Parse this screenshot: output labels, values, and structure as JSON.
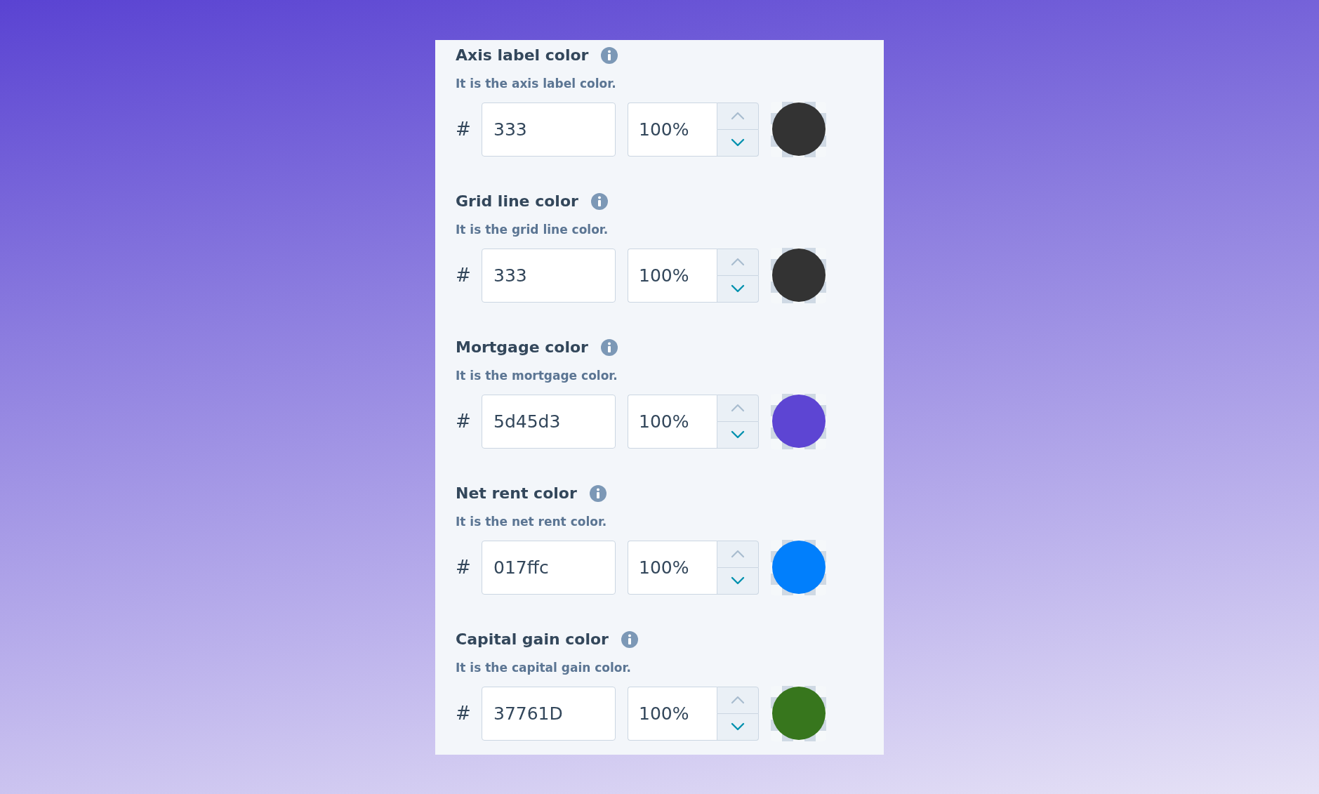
{
  "color_settings": [
    {
      "label": "Axis label color",
      "description": "It is the axis label color.",
      "prefix": "#",
      "hex": "333",
      "opacity": "100%",
      "increase_disabled": true,
      "color": "#333333"
    },
    {
      "label": "Grid line color",
      "description": "It is the grid line color.",
      "prefix": "#",
      "hex": "333",
      "opacity": "100%",
      "increase_disabled": true,
      "color": "#333333"
    },
    {
      "label": "Mortgage color",
      "description": "It is the mortgage color.",
      "prefix": "#",
      "hex": "5d45d3",
      "opacity": "100%",
      "increase_disabled": true,
      "color": "#5d45d3"
    },
    {
      "label": "Net rent color",
      "description": "It is the net rent color.",
      "prefix": "#",
      "hex": "017ffc",
      "opacity": "100%",
      "increase_disabled": true,
      "color": "#017ffc"
    },
    {
      "label": "Capital gain color",
      "description": "It is the capital gain color.",
      "prefix": "#",
      "hex": "37761D",
      "opacity": "100%",
      "increase_disabled": true,
      "color": "#37761d"
    }
  ]
}
